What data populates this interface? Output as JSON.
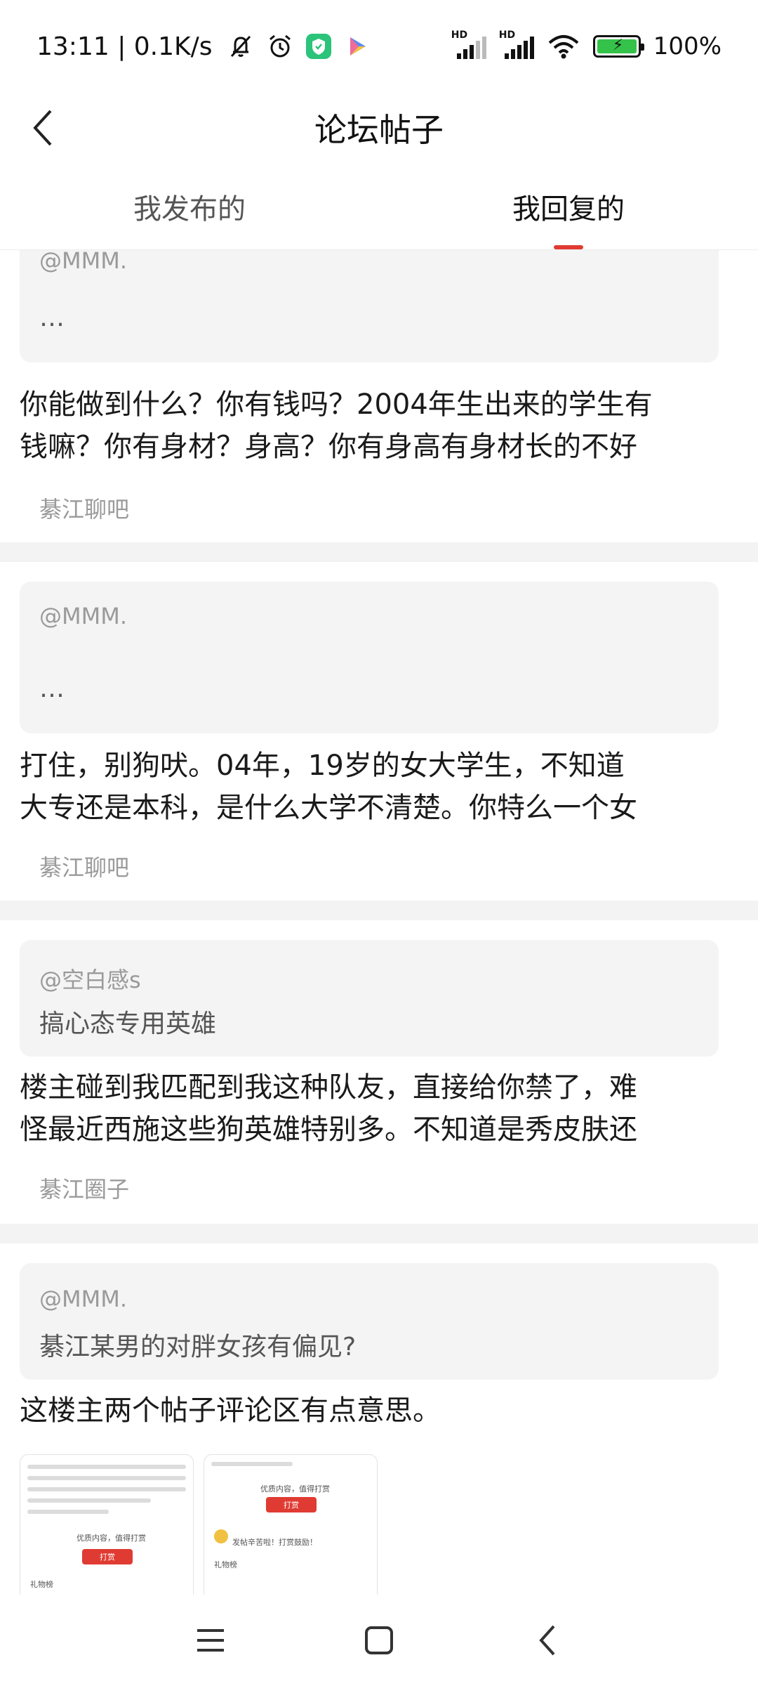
{
  "status_bar": {
    "time_speed": "13:11 | 0.1K/s",
    "battery": "100%",
    "sim1_label": "HD",
    "sim2_label": "HD"
  },
  "header": {
    "title": "论坛帖子"
  },
  "tabs": [
    {
      "label": "我发布的",
      "active": false
    },
    {
      "label": "我回复的",
      "active": true
    }
  ],
  "posts": [
    {
      "quote_user": "@MMM.",
      "quote_text": "…",
      "reply_line1": "你能做到什么？你有钱吗？2004年生出来的学生有",
      "reply_line2": "钱嘛？你有身材？身高？你有身高有身材长的不好",
      "forum": "綦江聊吧"
    },
    {
      "quote_user": "@MMM.",
      "quote_text": "…",
      "reply_line1": "打住，别狗吠。04年，19岁的女大学生，不知道",
      "reply_line2": "大专还是本科，是什么大学不清楚。你特么一个女",
      "forum": "綦江聊吧"
    },
    {
      "quote_user": "@空白感s",
      "quote_text": "搞心态专用英雄",
      "reply_line1": "楼主碰到我匹配到我这种队友，直接给你禁了，难",
      "reply_line2": "怪最近西施这些狗英雄特别多。不知道是秀皮肤还",
      "forum": "綦江圈子"
    },
    {
      "quote_user": "@MMM.",
      "quote_text": "綦江某男的对胖女孩有偏见?",
      "reply_line1": "这楼主两个帖子评论区有点意思。",
      "thumb1": {
        "text1": "优质内容，值得打赏",
        "button": "打赏",
        "text2": "礼物榜"
      },
      "thumb2": {
        "text1": "优质内容，值得打赏",
        "button": "打赏",
        "text2": "礼物榜",
        "text3": "发帖辛苦啦！打赏鼓励！"
      }
    }
  ],
  "colors": {
    "accent": "#e03b32",
    "separator": "#f3f3f3",
    "quote_bg": "#f4f4f4"
  },
  "nav": {
    "icons": [
      "menu-icon",
      "home-square-icon",
      "back-icon"
    ]
  }
}
